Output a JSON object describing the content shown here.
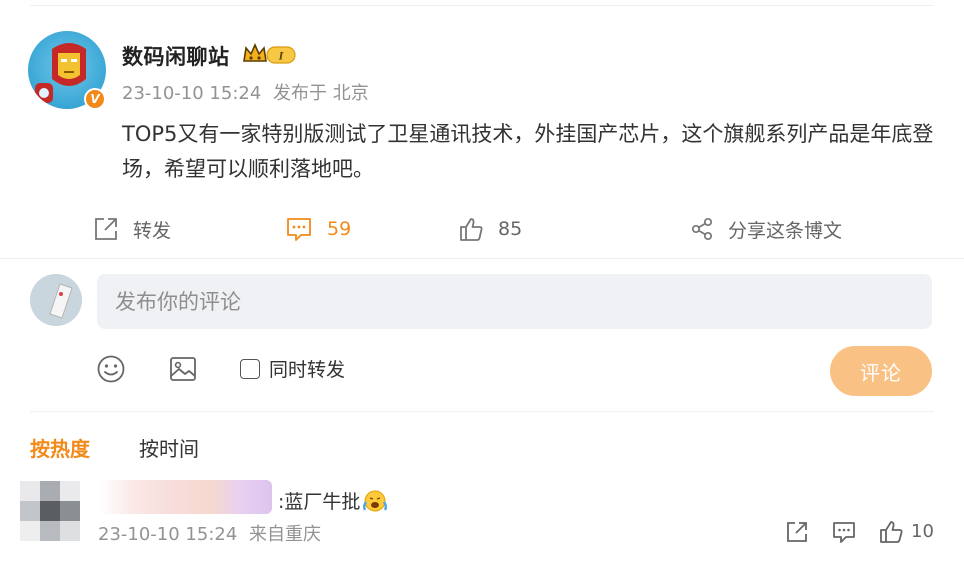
{
  "post": {
    "author": "数码闲聊站",
    "verify_badge": "V",
    "level_badge": "I",
    "time": "23-10-10 15:24",
    "source": "发布于 北京",
    "text": "TOP5又有一家特别版测试了卫星通讯技术，外挂国产芯片，这个旗舰系列产品是年底登场，希望可以顺利落地吧。"
  },
  "actions": {
    "repost_label": "转发",
    "comment_count": "59",
    "like_count": "85",
    "share_label": "分享这条博文"
  },
  "composer": {
    "placeholder": "发布你的评论",
    "sync_repost_label": "同时转发",
    "submit_label": "评论"
  },
  "sort": {
    "hot": "按热度",
    "time": "按时间"
  },
  "comments": [
    {
      "text": ":蓝厂牛批",
      "time": "23-10-10 15:24",
      "location": "来自重庆",
      "like_count": "10"
    }
  ],
  "colors": {
    "accent": "#f28a1a",
    "submit_disabled": "#f9c184",
    "meta_gray": "#939393",
    "input_bg": "#f0f1f4"
  },
  "icons": [
    "repost-icon",
    "comment-icon",
    "like-icon",
    "share-icon",
    "emoji-icon",
    "image-icon",
    "crown-icon"
  ]
}
